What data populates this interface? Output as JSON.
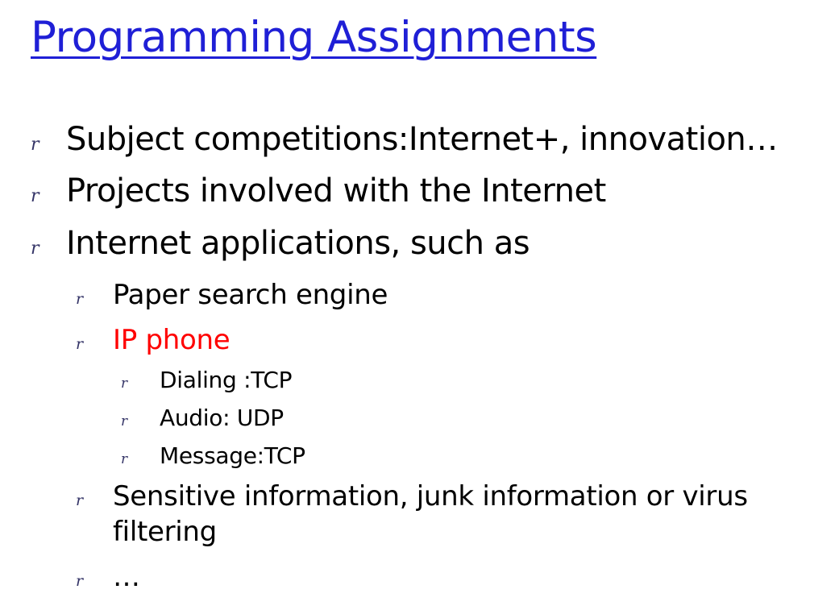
{
  "slide": {
    "title": "Programming Assignments",
    "bullet_marker": "r",
    "accent_color": "#1f1fd6",
    "highlight_color": "#ff0000",
    "items": [
      {
        "level": 1,
        "text": "Subject competitions:Internet+, innovation…"
      },
      {
        "level": 1,
        "text": "Projects involved with the Internet"
      },
      {
        "level": 1,
        "text": "Internet applications, such as"
      },
      {
        "level": 2,
        "text": "Paper search engine"
      },
      {
        "level": 2,
        "text": "IP phone"
      },
      {
        "level": 3,
        "text": "Dialing :TCP"
      },
      {
        "level": 3,
        "text": "Audio: UDP"
      },
      {
        "level": 3,
        "text": "Message:TCP"
      },
      {
        "level": 2,
        "text": "Sensitive information, junk information or virus filtering"
      },
      {
        "level": 2,
        "text": "…"
      }
    ]
  }
}
